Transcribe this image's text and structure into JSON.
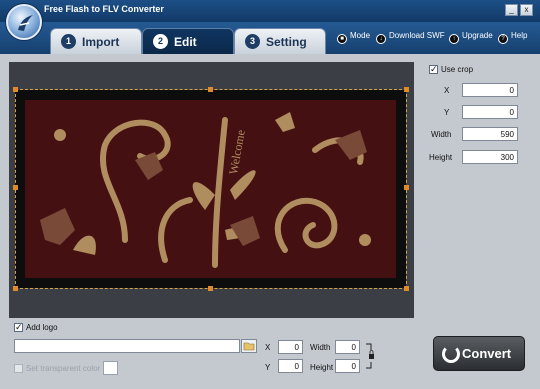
{
  "window": {
    "title": "Free Flash to FLV Converter",
    "minimize": "_",
    "close": "x"
  },
  "tabs": [
    {
      "num": "1",
      "label": "Import"
    },
    {
      "num": "2",
      "label": "Edit"
    },
    {
      "num": "3",
      "label": "Setting"
    }
  ],
  "toplinks": {
    "mode": "Mode",
    "download": "Download SWF",
    "upgrade": "Upgrade",
    "help": "Help"
  },
  "crop": {
    "use_crop_label": "Use crop",
    "x_label": "X",
    "x_value": "0",
    "y_label": "Y",
    "y_value": "0",
    "width_label": "Width",
    "width_value": "590",
    "height_label": "Height",
    "height_value": "300"
  },
  "preview": {
    "watermark_text": "Welcome"
  },
  "logo": {
    "add_logo_label": "Add logo",
    "file_path": "",
    "transparent_label": "Set transparent color",
    "x_label": "X",
    "x_value": "0",
    "y_label": "Y",
    "y_value": "0",
    "width_label": "Width",
    "width_value": "0",
    "height_label": "Height",
    "height_value": "0"
  },
  "convert": {
    "label": "Convert"
  },
  "colors": {
    "accent": "#1d4f86",
    "preview_bg": "#3b3f45",
    "art_bg": "#451012",
    "art_motif": "#b08d5f"
  }
}
